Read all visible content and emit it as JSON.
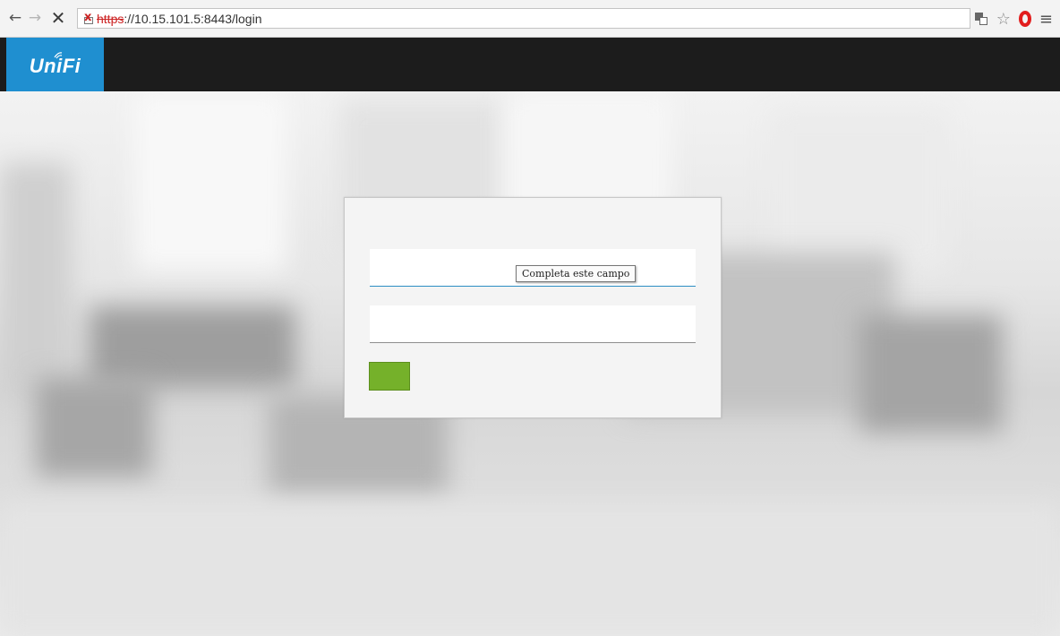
{
  "browser": {
    "url_scheme": "https",
    "url_rest": "://10.15.101.5:8443/login",
    "icons": [
      "back-arrow-icon",
      "forward-arrow-icon",
      "stop-icon",
      "insecure-lock-icon",
      "translate-icon",
      "bookmark-star-icon",
      "opera-icon",
      "menu-icon"
    ]
  },
  "app": {
    "logo": "UniFi",
    "brand_color": "#1f8fd0",
    "header_color": "#1c1c1c"
  },
  "login": {
    "username_value": "",
    "password_value": "",
    "button_label": "",
    "button_color": "#75b12a",
    "validation_tooltip": "Completa este campo"
  }
}
